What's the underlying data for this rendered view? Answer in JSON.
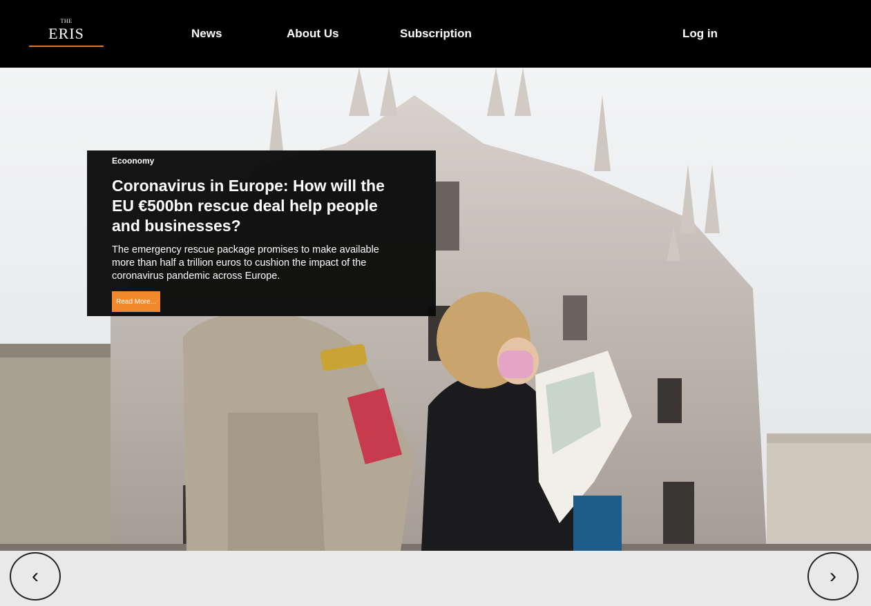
{
  "brand": {
    "the": "THE",
    "name": "ERIS"
  },
  "nav": {
    "items": [
      {
        "label": "News"
      },
      {
        "label": "About Us"
      },
      {
        "label": "Subscription"
      }
    ],
    "login": "Log in"
  },
  "hero": {
    "category": "Ecoonomy",
    "title": "Coronavirus in Europe: How will the EU €500bn rescue deal help people and businesses?",
    "description": "The emergency rescue package promises to make available more than half a trillion euros to cushion the impact of the coronavirus pandemic across Europe.",
    "read_more": "Read More..."
  },
  "carousel": {
    "prev": "‹",
    "next": "›"
  },
  "colors": {
    "accent": "#f08a2c",
    "nav_bg": "#000000"
  }
}
